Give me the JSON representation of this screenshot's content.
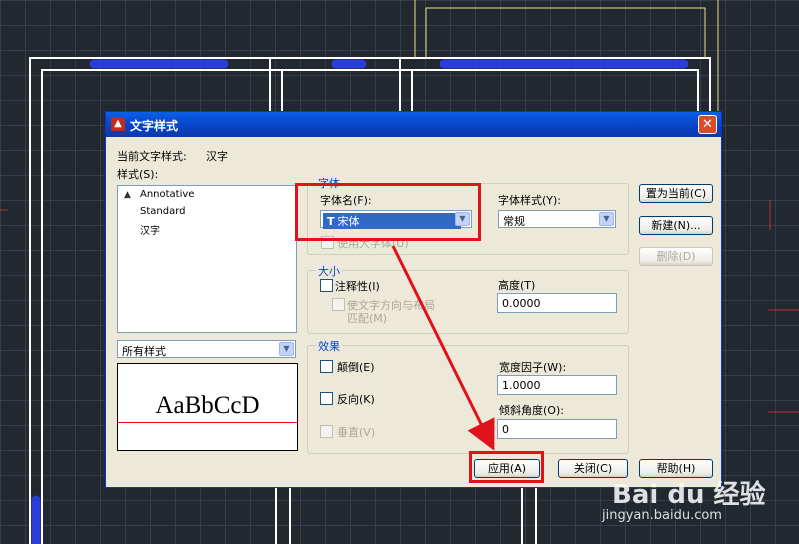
{
  "dialog": {
    "title": "文字样式",
    "close_glyph": "✕",
    "current_style_label": "当前文字样式:",
    "current_style_value": "汉字",
    "styles_label": "样式(S):",
    "styles": [
      "Annotative",
      "Standard",
      "汉字"
    ],
    "filter_value": "所有样式",
    "preview_text": "AaBbCcD",
    "font": {
      "group_title": "字体",
      "font_name_label": "字体名(F):",
      "font_name_value": "宋体",
      "font_style_label": "字体样式(Y):",
      "font_style_value": "常规",
      "big_font_label": "使用大字体(U)"
    },
    "size": {
      "group_title": "大小",
      "annotative_label": "注释性(I)",
      "match_layout_line1": "使文字方向与布局",
      "match_layout_line2": "匹配(M)",
      "height_label": "高度(T)",
      "height_value": "0.0000"
    },
    "effects": {
      "group_title": "效果",
      "upside_down_label": "颠倒(E)",
      "backwards_label": "反向(K)",
      "vertical_label": "垂直(V)",
      "width_factor_label": "宽度因子(W):",
      "width_factor_value": "1.0000",
      "oblique_label": "倾斜角度(O):",
      "oblique_value": "0"
    },
    "buttons": {
      "set_current": "置为当前(C)",
      "new": "新建(N)...",
      "delete": "删除(D)",
      "apply": "应用(A)",
      "close": "关闭(C)",
      "help": "帮助(H)"
    }
  },
  "watermark": {
    "brand": "Bai du 经验",
    "url": "jingyan.baidu.com"
  },
  "colors": {
    "title_bar": "#0842c4",
    "dialog_bg": "#ece9d8",
    "highlight": "#e0121a",
    "cad_bg": "#212830"
  }
}
